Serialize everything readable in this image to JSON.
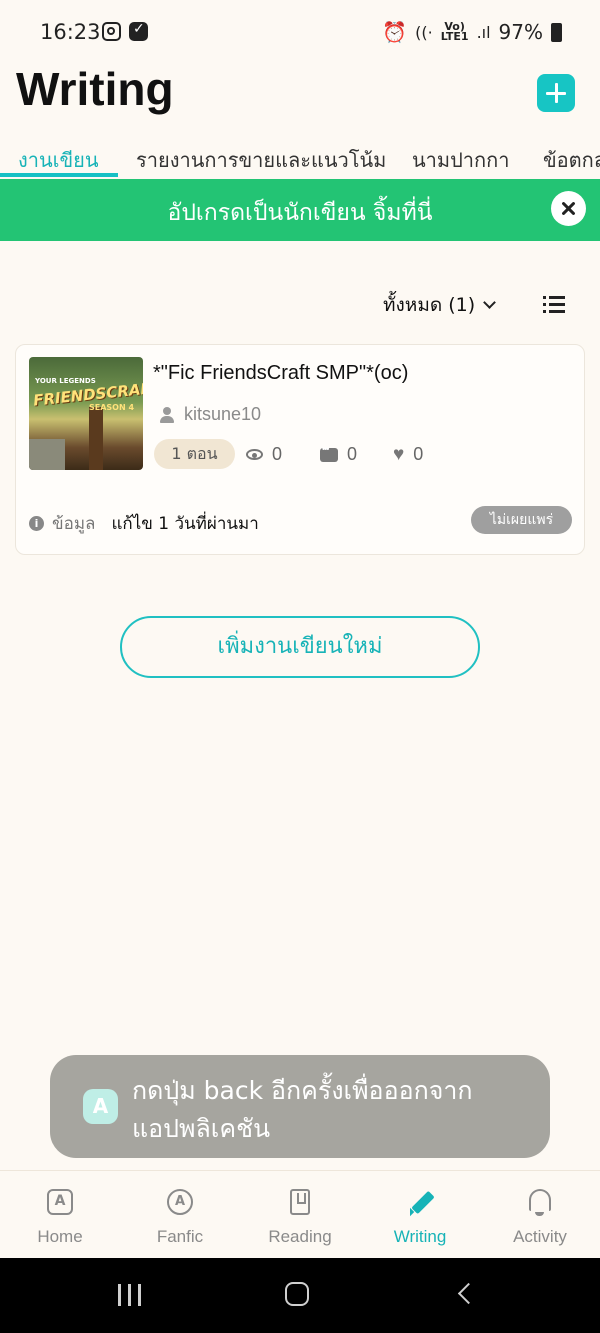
{
  "status_bar": {
    "time": "16:23",
    "network_label_top": "Vo)",
    "network_label_bottom": "LTE1",
    "battery": "97%"
  },
  "header": {
    "title": "Writing",
    "add_icon": "plus-icon",
    "accent_color": "#17c5c4"
  },
  "tabs": [
    {
      "label": "งานเขียน",
      "active": true
    },
    {
      "label": "รายงานการขายและแนวโน้ม",
      "active": false
    },
    {
      "label": "นามปากกา",
      "active": false
    },
    {
      "label": "ข้อตกล",
      "active": false
    }
  ],
  "banner": {
    "text": "อัปเกรดเป็นนักเขียน จิ้มที่นี่",
    "color": "#23c474",
    "close_icon": "close-icon"
  },
  "filter": {
    "label": "ทั้งหมด (1)",
    "list_icon": "list-view-icon"
  },
  "stories": [
    {
      "title": "*\"Fic FriendsCraft SMP\"*(oc)",
      "author": "kitsune10",
      "episodes": "1 ตอน",
      "views": "0",
      "comments": "0",
      "likes": "0",
      "info_label": "ข้อมูล",
      "edited": "แก้ไข 1 วันที่ผ่านมา",
      "status": "ไม่เผยแพร่",
      "cover": {
        "tag": "YOUR LEGENDS",
        "title": "FRIENDSCRAFT",
        "subtitle": "SEASON 4"
      }
    }
  ],
  "new_story_button": "เพิ่มงานเขียนใหม่",
  "toast": {
    "logo": "A",
    "text": "กดปุ่ม back อีกครั้งเพื่อออกจากแอปพลิเคชัน"
  },
  "bottom_nav": [
    {
      "label": "Home",
      "icon": "home-icon",
      "active": false
    },
    {
      "label": "Fanfic",
      "icon": "fanfic-icon",
      "active": false
    },
    {
      "label": "Reading",
      "icon": "reading-icon",
      "active": false
    },
    {
      "label": "Writing",
      "icon": "writing-icon",
      "active": true
    },
    {
      "label": "Activity",
      "icon": "bell-icon",
      "active": false
    }
  ]
}
